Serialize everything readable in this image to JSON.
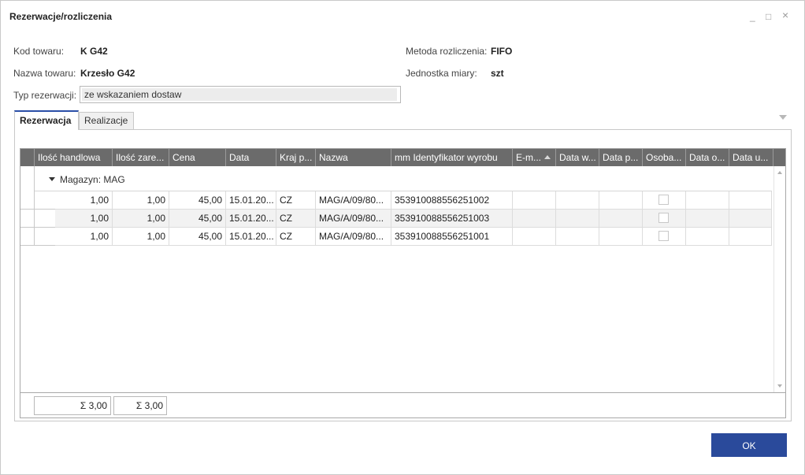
{
  "window": {
    "title": "Rezerwacje/rozliczenia",
    "controls": {
      "minimize": "_",
      "maximize": "□",
      "close": "×"
    }
  },
  "form": {
    "kod_label": "Kod towaru:",
    "kod_value": "K G42",
    "nazwa_label": "Nazwa towaru:",
    "nazwa_value": "Krzesło G42",
    "typ_label": "Typ rezerwacji:",
    "typ_value": "ze wskazaniem dostaw",
    "metoda_label": "Metoda rozliczenia:",
    "metoda_value": "FIFO",
    "jednostka_label": "Jednostka miary:",
    "jednostka_value": "szt"
  },
  "tabs": [
    {
      "label": "Rezerwacja",
      "active": true
    },
    {
      "label": "Realizacje",
      "active": false
    }
  ],
  "grid": {
    "columns": [
      "Ilość handlowa",
      "Ilość zare...",
      "Cena",
      "Data",
      "Kraj p...",
      "Nazwa",
      "mm Identyfikator wyrobu",
      "E-m...",
      "Data w...",
      "Data p...",
      "Osoba...",
      "Data o...",
      "Data u..."
    ],
    "sorted_column": "E-m...",
    "group_label": "Magazyn: MAG",
    "rows": [
      {
        "ilosc_handlowa": "1,00",
        "ilosc_zarezerwowana": "1,00",
        "cena": "45,00",
        "data": "15.01.20...",
        "kraj": "CZ",
        "nazwa": "MAG/A/09/80...",
        "identyfikator": "353910088556251002",
        "osoba_checked": false
      },
      {
        "ilosc_handlowa": "1,00",
        "ilosc_zarezerwowana": "1,00",
        "cena": "45,00",
        "data": "15.01.20...",
        "kraj": "CZ",
        "nazwa": "MAG/A/09/80...",
        "identyfikator": "353910088556251003",
        "osoba_checked": false
      },
      {
        "ilosc_handlowa": "1,00",
        "ilosc_zarezerwowana": "1,00",
        "cena": "45,00",
        "data": "15.01.20...",
        "kraj": "CZ",
        "nazwa": "MAG/A/09/80...",
        "identyfikator": "353910088556251001",
        "osoba_checked": false
      }
    ],
    "summary": {
      "ilosc_handlowa": "Σ  3,00",
      "ilosc_zarezerwowana": "Σ  3,00"
    }
  },
  "buttons": {
    "ok_label": "OK"
  },
  "colors": {
    "accent": "#2a4a9b",
    "header_bg": "#6b6b6b",
    "alt_row": "#f2f2f2"
  }
}
